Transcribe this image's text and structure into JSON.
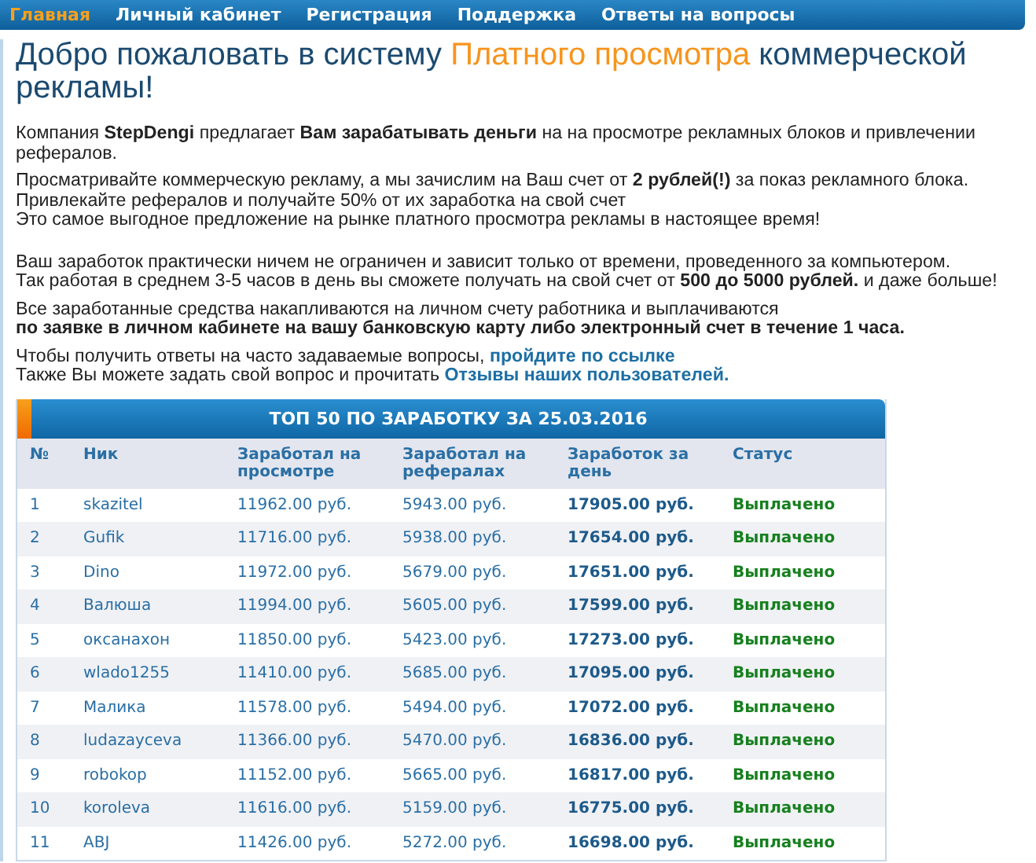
{
  "nav": [
    {
      "label": "Главная",
      "selected": true
    },
    {
      "label": "Личный кабинет",
      "selected": false
    },
    {
      "label": "Регистрация",
      "selected": false
    },
    {
      "label": "Поддержка",
      "selected": false
    },
    {
      "label": "Ответы на вопросы",
      "selected": false
    }
  ],
  "title": {
    "before": "Добро пожаловать в систему ",
    "highlight": "Платного просмотра",
    "after": " коммерческой рекламы!"
  },
  "paragraphs": [
    {
      "lines": [
        {
          "text": "Компания **StepDengi** предлагает **Вам зарабатывать деньги** на на просмотре рекламных блоков и привлечении рефералов."
        }
      ]
    },
    {
      "lines": [
        {
          "text": "Просматривайте коммерческую рекламу, а мы зачислим на Ваш счет от **2 рублей(!)** за показ рекламного блока."
        },
        {
          "text": "Привлекайте рефералов и получайте 50% от их заработка на свой счет"
        },
        {
          "text": "Это самое выгодное предложение на рынке платного просмотра рекламы в настоящее время!"
        }
      ]
    },
    {
      "lines": [
        {
          "text": "Ваш заработок практически ничем не ограничен и зависит только от времени, проведенного за компьютером."
        },
        {
          "text": "Так работая в среднем 3-5 часов в день вы сможете получать на свой счет от **500 до 5000 рублей.** и даже больше!"
        }
      ]
    },
    {
      "lines": [
        {
          "text": "Все заработанные средства накапливаются на личном счету работника и выплачиваются"
        },
        {
          "text": "**по заявке в личном кабинете на вашу банковскую карту либо электронный счет в течение 1 часа.**"
        }
      ]
    },
    {
      "lines": [
        {
          "text": "Чтобы получить ответы на часто задаваемые вопросы, ",
          "link": "пройдите по ссылке"
        },
        {
          "text": "Также Вы можете задать свой вопрос и прочитать ",
          "link": "Отзывы наших пользователей."
        }
      ]
    }
  ],
  "table": {
    "title": "ТОП 50 ПО ЗАРАБОТКУ ЗА 25.03.2016",
    "columns": [
      "№",
      "Ник",
      "Заработал на просмотре",
      "Заработал на рефералах",
      "Заработок за день",
      "Статус"
    ],
    "rows": [
      [
        "1",
        "skazitel",
        "11962.00 руб.",
        "5943.00 руб.",
        "17905.00 руб.",
        "Выплачено"
      ],
      [
        "2",
        "Gufik",
        "11716.00 руб.",
        "5938.00 руб.",
        "17654.00 руб.",
        "Выплачено"
      ],
      [
        "3",
        "Dino",
        "11972.00 руб.",
        "5679.00 руб.",
        "17651.00 руб.",
        "Выплачено"
      ],
      [
        "4",
        "Валюша",
        "11994.00 руб.",
        "5605.00 руб.",
        "17599.00 руб.",
        "Выплачено"
      ],
      [
        "5",
        "оксанахон",
        "11850.00 руб.",
        "5423.00 руб.",
        "17273.00 руб.",
        "Выплачено"
      ],
      [
        "6",
        "wlado1255",
        "11410.00 руб.",
        "5685.00 руб.",
        "17095.00 руб.",
        "Выплачено"
      ],
      [
        "7",
        "Малика",
        "11578.00 руб.",
        "5494.00 руб.",
        "17072.00 руб.",
        "Выплачено"
      ],
      [
        "8",
        "ludazayceva",
        "11366.00 руб.",
        "5470.00 руб.",
        "16836.00 руб.",
        "Выплачено"
      ],
      [
        "9",
        "robokop",
        "11152.00 руб.",
        "5665.00 руб.",
        "16817.00 руб.",
        "Выплачено"
      ],
      [
        "10",
        "koroleva",
        "11616.00 руб.",
        "5159.00 руб.",
        "16775.00 руб.",
        "Выплачено"
      ],
      [
        "11",
        "ABJ",
        "11426.00 руб.",
        "5272.00 руб.",
        "16698.00 руб.",
        "Выплачено"
      ]
    ]
  }
}
